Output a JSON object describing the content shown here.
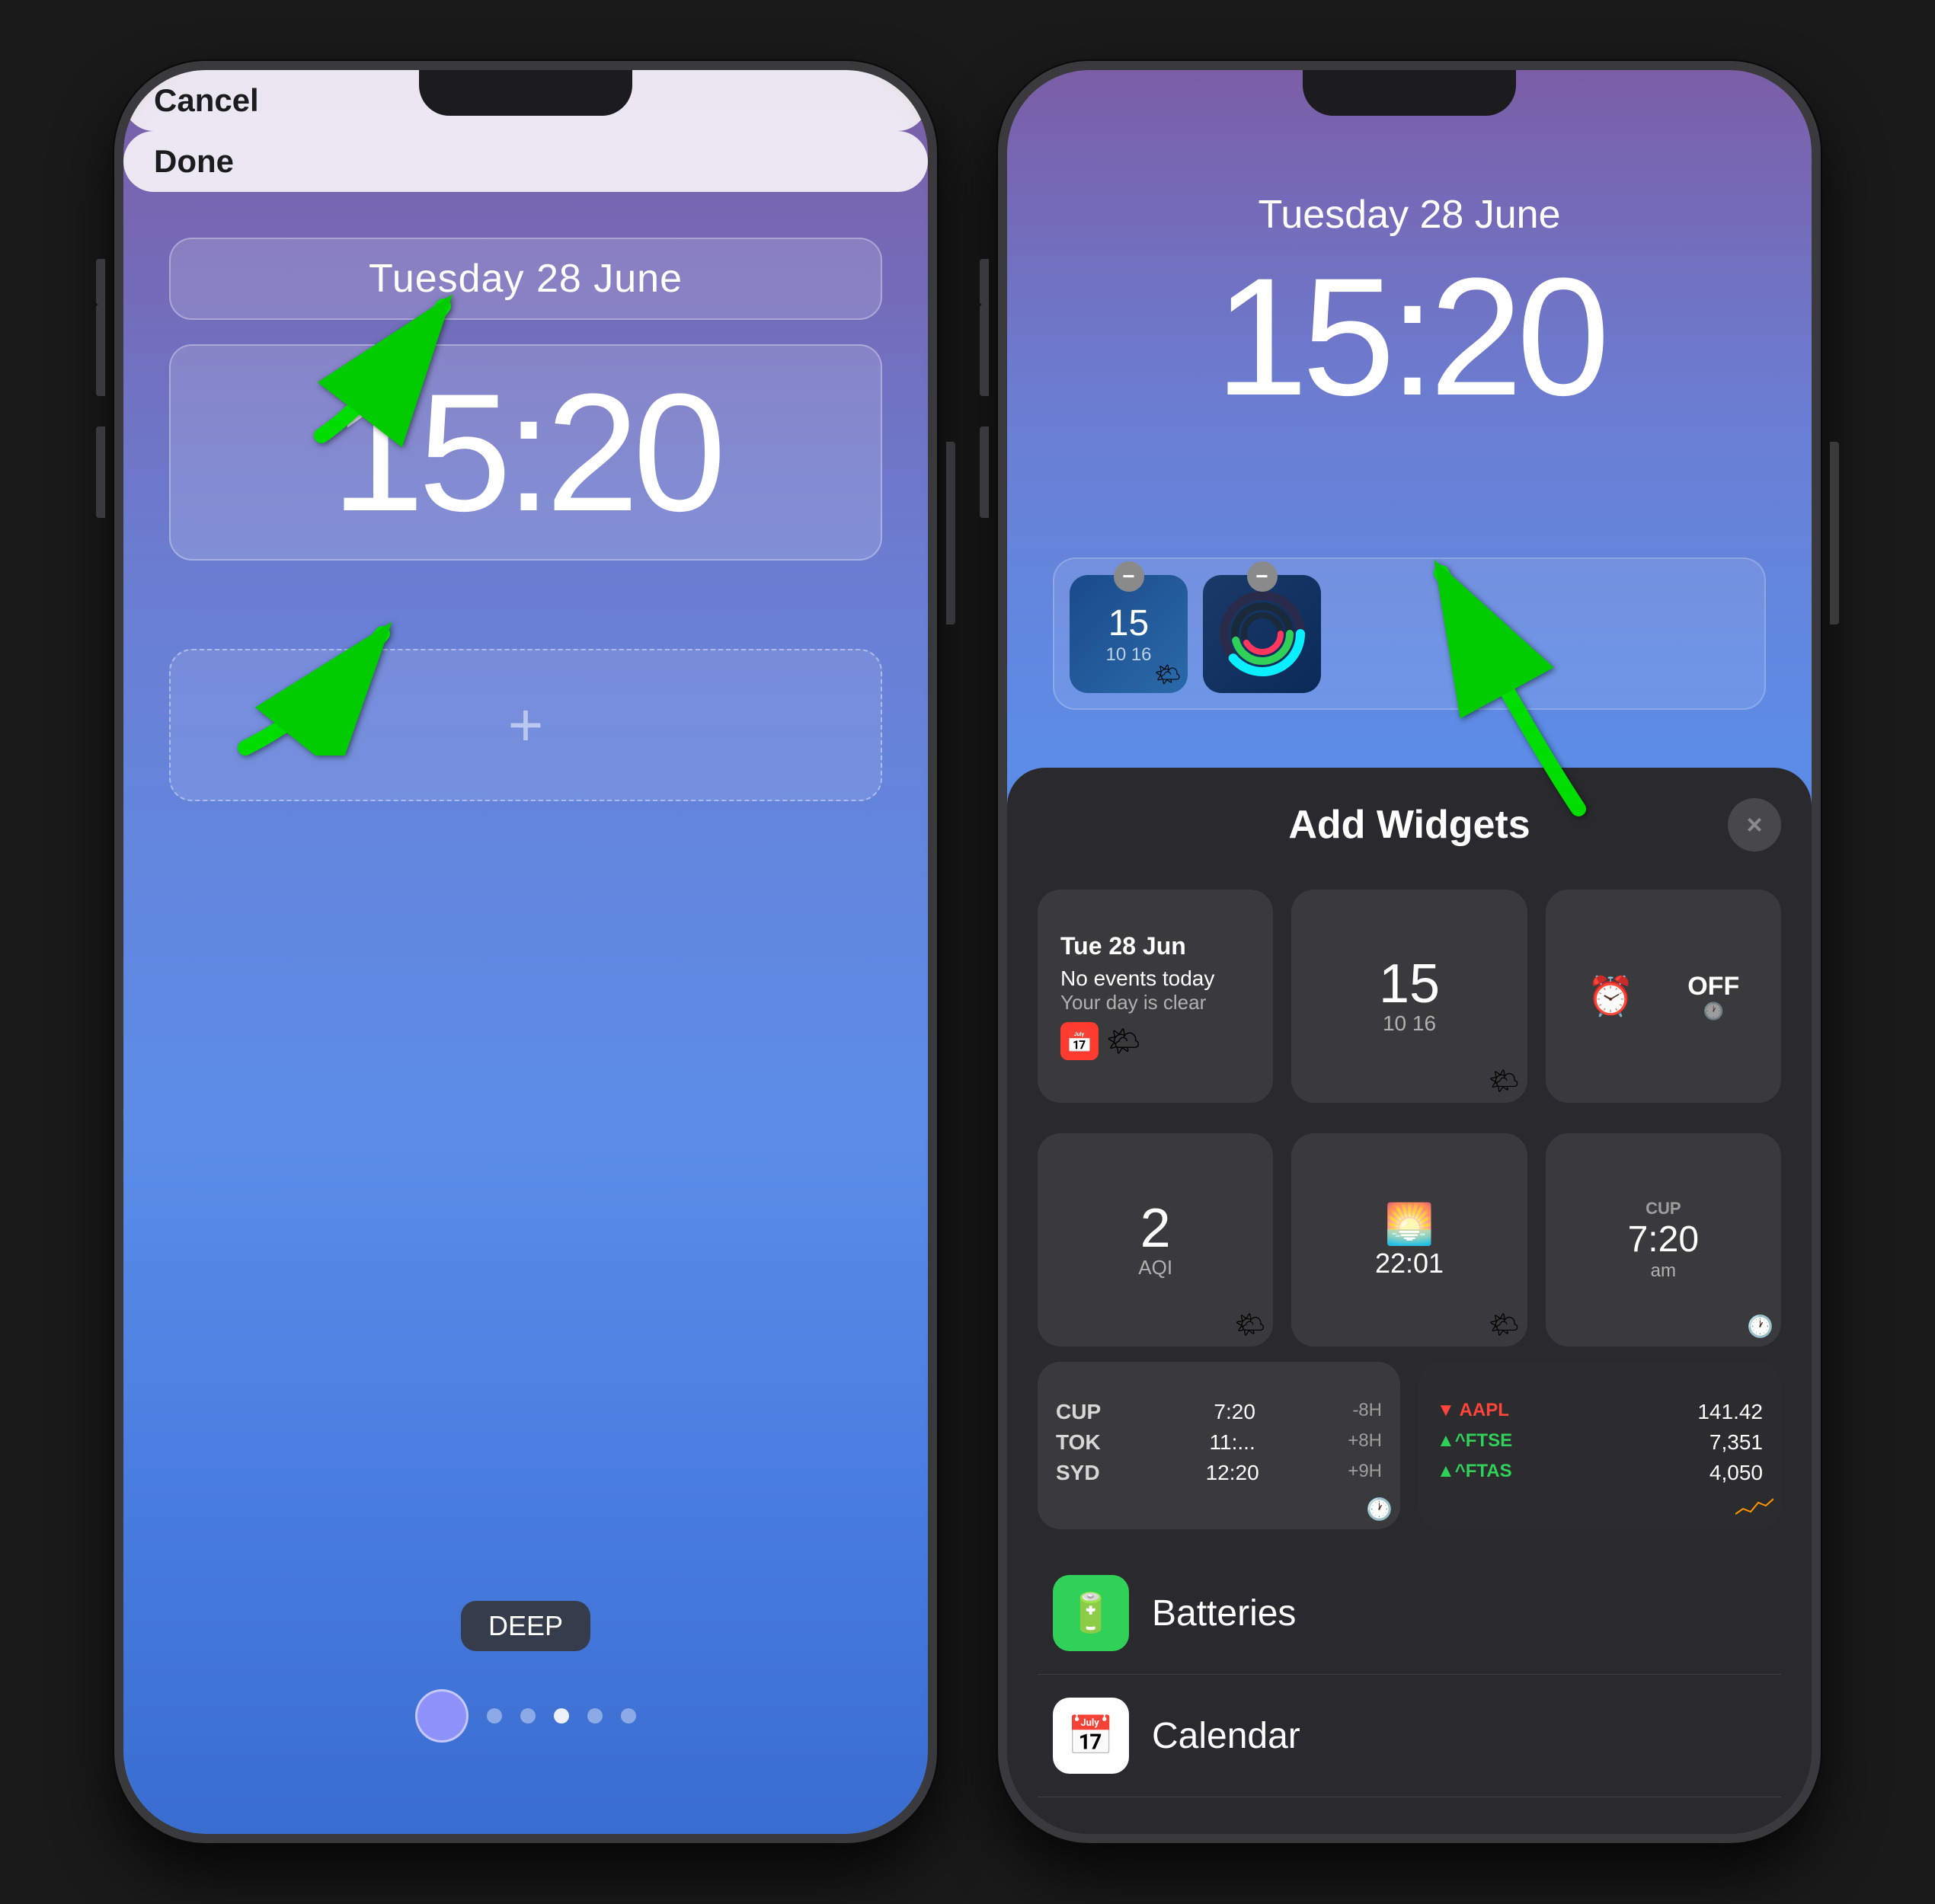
{
  "phone1": {
    "cancel_label": "Cancel",
    "done_label": "Done",
    "date": "Tuesday 28 June",
    "time": "15:20",
    "add_widget_icon": "+",
    "wallpaper_label": "DEEP",
    "dots": [
      "active",
      "",
      "",
      "",
      "current",
      ""
    ],
    "arrows": [
      {
        "id": "arrow-date",
        "direction": "up-right"
      },
      {
        "id": "arrow-widget",
        "direction": "up-left"
      }
    ]
  },
  "phone2": {
    "date": "Tuesday 28 June",
    "time": "15:20",
    "panel": {
      "title": "Add Widgets",
      "close_icon": "×",
      "widgets": [
        {
          "type": "calendar",
          "date_label": "Tue 28 Jun",
          "no_events": "No events today",
          "day_clear": "Your day is clear"
        },
        {
          "type": "clock",
          "number": "15",
          "sub": "10  16"
        },
        {
          "type": "alarm",
          "label": "OFF"
        },
        {
          "type": "aqi",
          "number": "2",
          "label": "AQI"
        },
        {
          "type": "time",
          "value": "22:01"
        },
        {
          "type": "worldclock_cup",
          "cup_label": "CUP",
          "cup_time": "7:20",
          "cup_period": "am",
          "cup_offset": ""
        },
        {
          "type": "activity",
          "label": ""
        }
      ],
      "world_clock": {
        "rows": [
          {
            "city": "CUP",
            "time": "7:20",
            "offset": "-8H"
          },
          {
            "city": "TOK",
            "time": "11:...",
            "offset": "+8H"
          },
          {
            "city": "SYD",
            "time": "12:20",
            "offset": "+9H"
          }
        ]
      },
      "stocks": {
        "rows": [
          {
            "name": "▼ AAPL",
            "value": "141.42"
          },
          {
            "name": "▲^FTSE",
            "value": "7,351"
          },
          {
            "name": "▲^FTAS",
            "value": "4,050"
          }
        ]
      },
      "sections": [
        {
          "icon": "🔋",
          "label": "Batteries",
          "icon_bg": "batteries"
        },
        {
          "icon": "📅",
          "label": "Calendar",
          "icon_bg": "calendar"
        }
      ]
    },
    "mini_widgets": [
      {
        "type": "clock",
        "number": "15",
        "sub": "10  16",
        "remove": true
      },
      {
        "type": "activity",
        "remove": true
      }
    ]
  }
}
